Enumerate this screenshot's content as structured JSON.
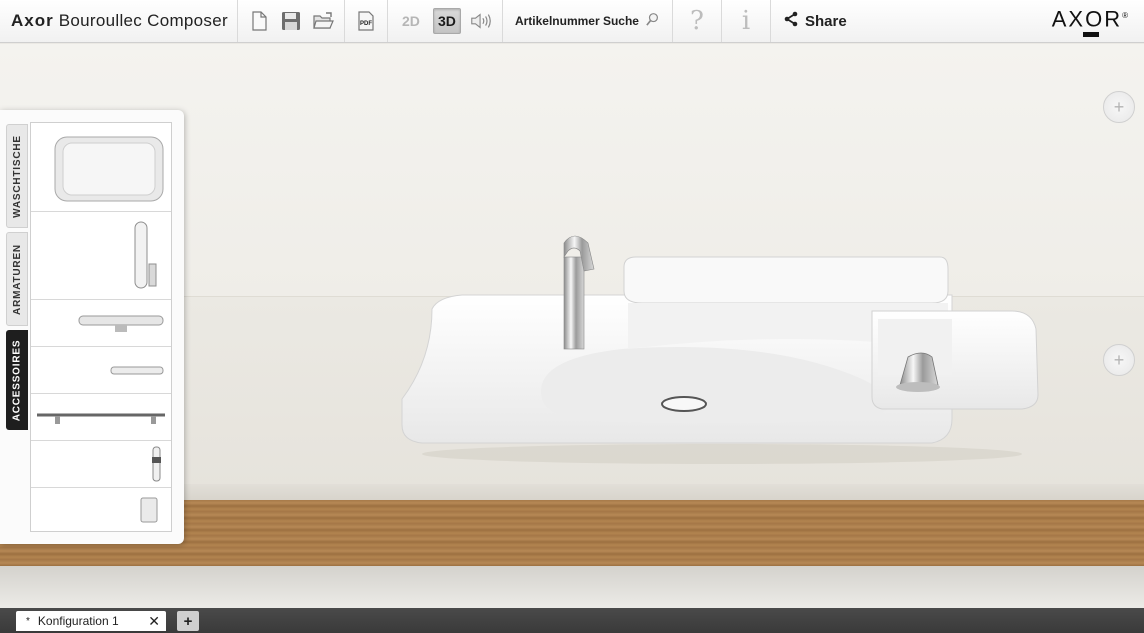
{
  "app": {
    "title_brand": "Axor",
    "title_rest": "Bouroullec Composer"
  },
  "toolbar": {
    "icons": [
      "new-document-icon",
      "save-icon",
      "open-folder-icon",
      "pdf-icon"
    ],
    "pdf_label": "PDF",
    "mode_2d": "2D",
    "mode_3d": "3D",
    "active_mode": "3D",
    "sound_icon": "speaker-icon",
    "search_label": "Artikelnummer Suche",
    "help_label": "?",
    "info_label": "i",
    "share_label": "Share"
  },
  "brand": {
    "logo": "AXOR",
    "registered": "®"
  },
  "side_panel": {
    "tabs": [
      {
        "label": "WASCHTISCHE",
        "active": false
      },
      {
        "label": "ARMATUREN",
        "active": false
      },
      {
        "label": "ACCESSOIRES",
        "active": true
      }
    ],
    "items": [
      {
        "name": "washbasin-thumbnail"
      },
      {
        "name": "faucet-thumbnail"
      },
      {
        "name": "shelf-bowl-thumbnail"
      },
      {
        "name": "small-shelf-thumbnail"
      },
      {
        "name": "towel-bar-thumbnail"
      },
      {
        "name": "small-fitting-thumbnail"
      },
      {
        "name": "holder-thumbnail"
      }
    ]
  },
  "stage": {
    "zoom_label": "+"
  },
  "bottom_tabs": {
    "modified_marker": "*",
    "document_name": "Konfiguration 1",
    "close_label": "✕",
    "add_label": "+"
  }
}
